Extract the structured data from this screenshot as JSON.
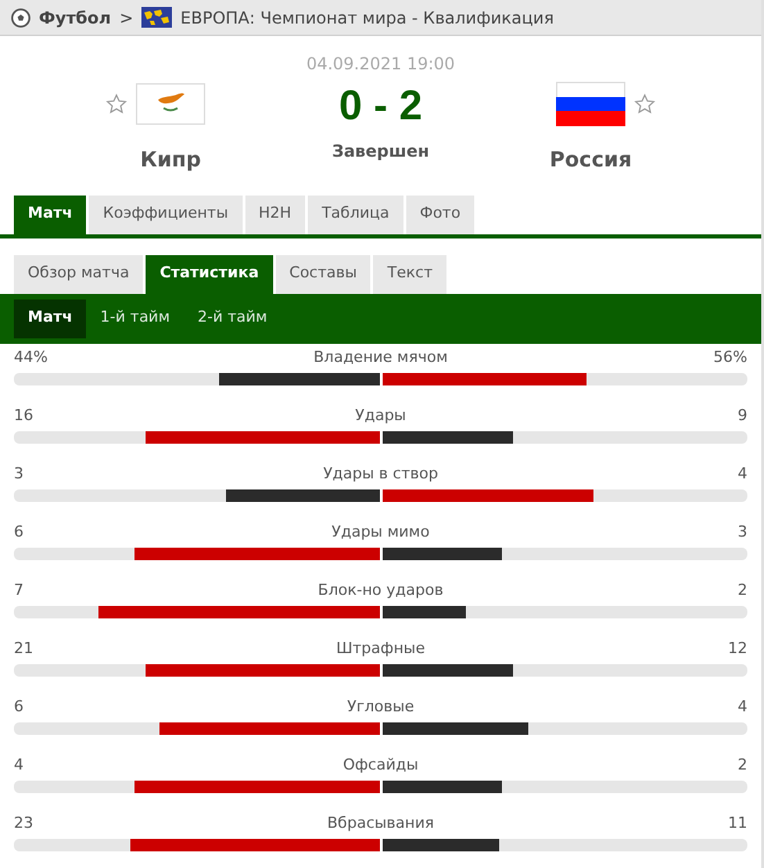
{
  "breadcrumb": {
    "sport": "Футбол",
    "separator": ">",
    "competition": "ЕВРОПА: Чемпионат мира - Квалификация"
  },
  "match": {
    "datetime": "04.09.2021 19:00",
    "score": "0 - 2",
    "status": "Завершен",
    "home": {
      "name": "Кипр",
      "favorite": false
    },
    "away": {
      "name": "Россия",
      "favorite": false
    }
  },
  "main_tabs": [
    {
      "label": "Матч",
      "selected": true
    },
    {
      "label": "Коэффициенты",
      "selected": false
    },
    {
      "label": "H2H",
      "selected": false
    },
    {
      "label": "Таблица",
      "selected": false
    },
    {
      "label": "Фото",
      "selected": false
    }
  ],
  "sub_tabs": [
    {
      "label": "Обзор матча",
      "selected": false
    },
    {
      "label": "Статистика",
      "selected": true
    },
    {
      "label": "Составы",
      "selected": false
    },
    {
      "label": "Текст",
      "selected": false
    }
  ],
  "period_tabs": [
    {
      "label": "Матч",
      "selected": true
    },
    {
      "label": "1-й тайм",
      "selected": false
    },
    {
      "label": "2-й тайм",
      "selected": false
    }
  ],
  "stats": [
    {
      "name": "Владение мячом",
      "home": {
        "value": "44%",
        "level": 0.44,
        "leading": false
      },
      "away": {
        "value": "56%",
        "level": 0.56,
        "leading": true
      }
    },
    {
      "name": "Удары",
      "home": {
        "value": "16",
        "level": 0.64,
        "leading": true
      },
      "away": {
        "value": "9",
        "level": 0.36,
        "leading": false
      }
    },
    {
      "name": "Удары в створ",
      "home": {
        "value": "3",
        "level": 0.42,
        "leading": false
      },
      "away": {
        "value": "4",
        "level": 0.58,
        "leading": true
      }
    },
    {
      "name": "Удары мимо",
      "home": {
        "value": "6",
        "level": 0.67,
        "leading": true
      },
      "away": {
        "value": "3",
        "level": 0.33,
        "leading": false
      }
    },
    {
      "name": "Блок-но ударов",
      "home": {
        "value": "7",
        "level": 0.77,
        "leading": true
      },
      "away": {
        "value": "2",
        "level": 0.23,
        "leading": false
      }
    },
    {
      "name": "Штрафные",
      "home": {
        "value": "21",
        "level": 0.64,
        "leading": true
      },
      "away": {
        "value": "12",
        "level": 0.36,
        "leading": false
      }
    },
    {
      "name": "Угловые",
      "home": {
        "value": "6",
        "level": 0.6,
        "leading": true
      },
      "away": {
        "value": "4",
        "level": 0.4,
        "leading": false
      }
    },
    {
      "name": "Офсайды",
      "home": {
        "value": "4",
        "level": 0.67,
        "leading": true
      },
      "away": {
        "value": "2",
        "level": 0.33,
        "leading": false
      }
    },
    {
      "name": "Вбрасывания",
      "home": {
        "value": "23",
        "level": 0.68,
        "leading": true
      },
      "away": {
        "value": "11",
        "level": 0.32,
        "leading": false
      }
    }
  ]
}
